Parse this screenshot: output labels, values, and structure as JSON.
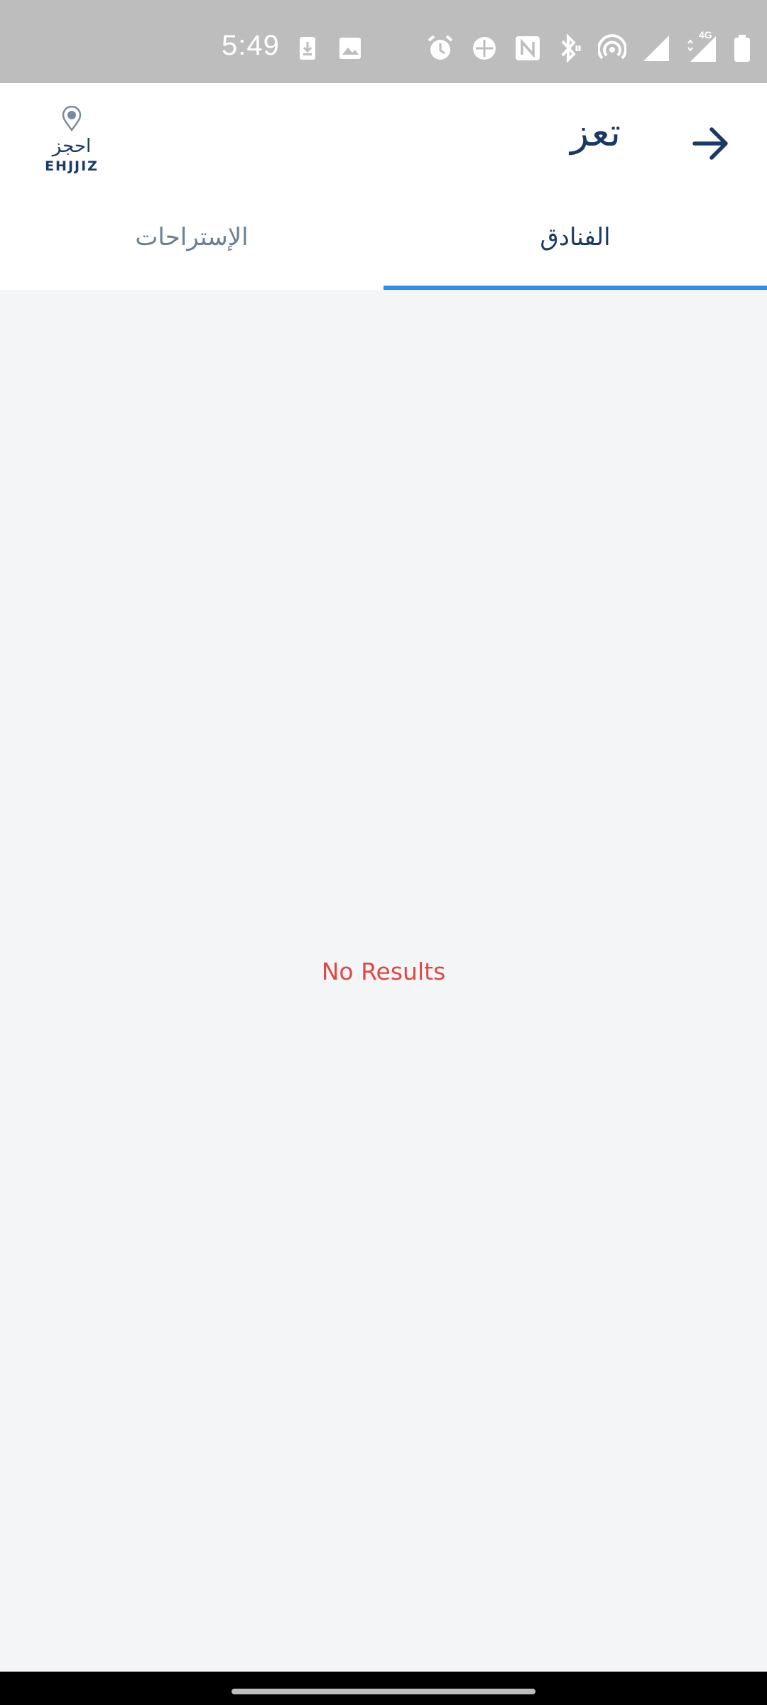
{
  "status_bar": {
    "time": "5:49",
    "network": "4G",
    "icons": [
      "download-icon",
      "image-icon",
      "alarm-icon",
      "data-saver-icon",
      "nfc-icon",
      "bluetooth-icon",
      "hotspot-icon",
      "wifi-signal-icon",
      "cell-signal-icon",
      "battery-icon"
    ]
  },
  "header": {
    "title": "تعز",
    "back_icon": "arrow-right-icon",
    "logo": {
      "arabic": "احجز",
      "english": "EHJJIZ"
    }
  },
  "tabs": [
    {
      "label": "الفنادق",
      "active": true
    },
    {
      "label": "الإستراحات",
      "active": false
    }
  ],
  "content": {
    "empty_message": "No Results"
  },
  "colors": {
    "primary": "#1b3a63",
    "accent": "#2f8fe0",
    "error": "#e04848",
    "background": "#f4f5f7"
  }
}
